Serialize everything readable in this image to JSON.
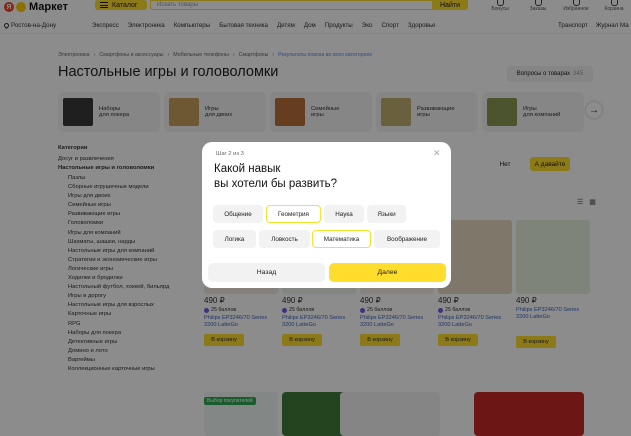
{
  "header": {
    "logo_text": "Маркет",
    "logo_ya": "Я",
    "catalog_label": "Каталог",
    "search_placeholder": "Искать товары",
    "search_button": "Найти",
    "icons": [
      {
        "name": "bonus-icon",
        "label": "Бонусы"
      },
      {
        "name": "orders-icon",
        "label": "Заказы"
      },
      {
        "name": "favorites-icon",
        "label": "Избранное"
      },
      {
        "name": "cart-icon",
        "label": "Корзина"
      }
    ]
  },
  "nav": {
    "city": "Ростов-на-Дону",
    "links": [
      "Экспресс",
      "Электроника",
      "Компьютеры",
      "Бытовая техника",
      "Детям",
      "Дом",
      "Продукты",
      "Эко",
      "Спорт",
      "Здоровье"
    ],
    "right_links": [
      "Транспорт",
      "Журнал Ма"
    ]
  },
  "breadcrumbs": [
    "Электроника",
    "Смартфоны и аксессуары",
    "Мобильные телефоны",
    "Смартфоны",
    "Результаты поиска во всех категориях"
  ],
  "page_title": "Настольные игры и головоломки",
  "questions": {
    "label": "Вопросы о товарах",
    "count": "345"
  },
  "subcategories": [
    {
      "label1": "Наборы",
      "label2": "для покера",
      "color": "#3a3a3a"
    },
    {
      "label1": "Игры",
      "label2": "для двоих",
      "color": "#c9a15a"
    },
    {
      "label1": "Семейные",
      "label2": "игры",
      "color": "#b86f3a"
    },
    {
      "label1": "Развивающие",
      "label2": "игры",
      "color": "#c4b070"
    },
    {
      "label1": "Игры",
      "label2": "для компаний",
      "color": "#8a9a55"
    }
  ],
  "sidebar": {
    "heading": "Категории",
    "parent": "Досуг и развлечения",
    "current": "Настольные игры и головоломки",
    "items": [
      "Пазлы",
      "Сборные игрушечные модели",
      "Игры для двоих",
      "Семейные игры",
      "Развивающие игры",
      "Головоломки",
      "Игры для компаний",
      "Шахматы, шашки, нарды",
      "Настольные игры для компаний",
      "Стратегии и экономические игры",
      "Логические игры",
      "Ходилки и бродилки",
      "Настольный футбол, хоккей, бильярд",
      "Игры в дорогу",
      "Настольные игры для взрослых",
      "Карточные игры",
      "RPG",
      "Наборы для покера",
      "Детективные игры",
      "Домино и лото",
      "Варгеймы",
      "Коллекционные карточные игры"
    ]
  },
  "prefs": {
    "no": "Нет",
    "yes": "А давайте"
  },
  "products": [
    {
      "price": "490 ₽",
      "bonus": "25 баллов",
      "name": "Philips EP3246/70 Series 3200 LatteGo",
      "cart": "В корзину"
    },
    {
      "price": "490 ₽",
      "bonus": "25 баллов",
      "name": "Philips EP3246/70 Series 3200 LatteGo",
      "cart": "В корзину"
    },
    {
      "price": "490 ₽",
      "bonus": "25 баллов",
      "name": "Philips EP3246/70 Series 3200 LatteGo",
      "cart": "В корзину"
    },
    {
      "price": "490 ₽",
      "bonus": "25 баллов",
      "name": "Philips EP3246/70 Series 3200 LatteGo",
      "cart": "В корзину"
    },
    {
      "price": "490 ₽",
      "bonus": "",
      "name": "Philips EP3246/70 Series 3200 LatteGo",
      "cart": "В корзину"
    }
  ],
  "promo_badge": "Выбор покупателей",
  "modal": {
    "step": "Шаг 2 из 3",
    "question_line1": "Какой навык",
    "question_line2": "вы хотели бы развить?",
    "chips": [
      {
        "label": "Общение",
        "selected": false
      },
      {
        "label": "Геометрия",
        "selected": true
      },
      {
        "label": "Наука",
        "selected": false
      },
      {
        "label": "Языки",
        "selected": false
      },
      {
        "label": "Логика",
        "selected": false
      },
      {
        "label": "Ловкость",
        "selected": false
      },
      {
        "label": "Математика",
        "selected": true
      },
      {
        "label": "Воображение",
        "selected": false
      }
    ],
    "back": "Назад",
    "next": "Далее"
  },
  "colors": {
    "accent": "#ffdd2d",
    "brand_red": "#fc3f1d",
    "link": "#3d63b9",
    "promo_green": "#2fa84f"
  }
}
